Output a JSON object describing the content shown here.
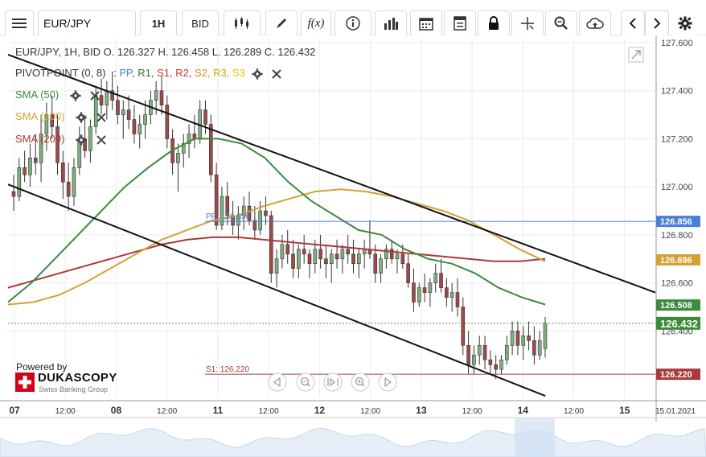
{
  "toolbar": {
    "symbol": "EUR/JPY",
    "period": "1H",
    "price_type": "BID",
    "fx_label": "f(x)",
    "icons": [
      "menu-icon",
      "candles-icon",
      "pencil-icon",
      "function-icon",
      "info-icon",
      "volume-icon",
      "calendar-icon",
      "report-icon",
      "lock-icon",
      "crosshair-icon",
      "zoom-icon",
      "cloud-upload-icon",
      "prev-icon",
      "next-icon",
      "gear-icon"
    ]
  },
  "legend": {
    "ohlc": "EUR/JPY, 1H, BID    O. 126.327 H. 126.458 L. 126.289 C. 126.432",
    "pivot_label": "PIVOTPOINT (0, 8)",
    "pivot_colon": ":",
    "pivot_items": [
      {
        "text": "PP,",
        "color": "#4a7fd4"
      },
      {
        "text": "R1,",
        "color": "#2b7a2b"
      },
      {
        "text": "S1,",
        "color": "#c0392b"
      },
      {
        "text": "R2,",
        "color": "#c0392b"
      },
      {
        "text": "S2,",
        "color": "#e08a1e"
      },
      {
        "text": "R3,",
        "color": "#d4a900"
      },
      {
        "text": "S3",
        "color": "#e0c400"
      }
    ],
    "sma50": "SMA (50)",
    "sma100": "SMA (100)",
    "sma200": "SMA (200)",
    "colors": {
      "sma50": "#3d8a3d",
      "sma100": "#d4a233",
      "sma200": "#a83a3a"
    }
  },
  "overlay_labels": {
    "pp": "PP: 126.856",
    "s1": "S1: 126.220"
  },
  "branding": {
    "powered": "Powered by",
    "name": "DUKASCOPY",
    "sub": "Swiss Banking Group"
  },
  "chart_data": {
    "type": "candlestick",
    "symbol": "EUR/JPY",
    "timeframe": "1H",
    "ylim": [
      126.12,
      127.62
    ],
    "y_ticks": [
      "127.600",
      "127.400",
      "127.200",
      "127.000",
      "126.800",
      "126.600",
      "126.400"
    ],
    "x_ticks": [
      "07",
      "12:00",
      "08",
      "12:00",
      "11",
      "12:00",
      "12",
      "12:00",
      "13",
      "12:00",
      "14",
      "12:00",
      "15",
      "15.01.2021"
    ],
    "price_tags": [
      {
        "label": "126.856",
        "value": 126.856,
        "color": "#4a7fd4"
      },
      {
        "label": "126.696",
        "value": 126.696,
        "color": "#d4a233"
      },
      {
        "label": "126.508",
        "value": 126.508,
        "color": "#3d8a3d"
      },
      {
        "label": "126.432",
        "value": 126.432,
        "color": "#3d8a3d"
      },
      {
        "label": "126.220",
        "value": 126.22,
        "color": "#a83a3a"
      }
    ],
    "levels": {
      "pp": 126.856,
      "s1": 126.22
    },
    "candles": [
      [
        126.98,
        127.05,
        126.9,
        126.96
      ],
      [
        126.96,
        127.12,
        126.94,
        127.08
      ],
      [
        127.08,
        127.15,
        127.02,
        127.05
      ],
      [
        127.05,
        127.18,
        127.0,
        127.12
      ],
      [
        127.12,
        127.22,
        127.05,
        127.1
      ],
      [
        127.1,
        127.3,
        127.02,
        127.22
      ],
      [
        127.22,
        127.35,
        127.15,
        127.3
      ],
      [
        127.3,
        127.38,
        127.2,
        127.25
      ],
      [
        127.25,
        127.3,
        127.05,
        127.1
      ],
      [
        127.1,
        127.15,
        126.95,
        127.02
      ],
      [
        127.02,
        127.1,
        126.9,
        126.96
      ],
      [
        126.96,
        127.12,
        126.92,
        127.08
      ],
      [
        127.08,
        127.25,
        127.05,
        127.2
      ],
      [
        127.2,
        127.3,
        127.12,
        127.15
      ],
      [
        127.15,
        127.28,
        127.1,
        127.25
      ],
      [
        127.25,
        127.42,
        127.22,
        127.38
      ],
      [
        127.38,
        127.45,
        127.3,
        127.34
      ],
      [
        127.34,
        127.44,
        127.28,
        127.4
      ],
      [
        127.4,
        127.48,
        127.32,
        127.36
      ],
      [
        127.36,
        127.42,
        127.26,
        127.3
      ],
      [
        127.3,
        127.36,
        127.2,
        127.32
      ],
      [
        127.32,
        127.38,
        127.24,
        127.28
      ],
      [
        127.28,
        127.34,
        127.18,
        127.22
      ],
      [
        127.22,
        127.3,
        127.16,
        127.26
      ],
      [
        127.26,
        127.36,
        127.2,
        127.3
      ],
      [
        127.3,
        127.4,
        127.26,
        127.36
      ],
      [
        127.36,
        127.44,
        127.3,
        127.4
      ],
      [
        127.4,
        127.46,
        127.3,
        127.34
      ],
      [
        127.34,
        127.38,
        127.16,
        127.2
      ],
      [
        127.2,
        127.24,
        127.05,
        127.1
      ],
      [
        127.1,
        127.18,
        126.98,
        127.14
      ],
      [
        127.14,
        127.22,
        127.08,
        127.18
      ],
      [
        127.18,
        127.26,
        127.12,
        127.22
      ],
      [
        127.22,
        127.3,
        127.16,
        127.2
      ],
      [
        127.2,
        127.36,
        127.18,
        127.32
      ],
      [
        127.32,
        127.36,
        127.22,
        127.26
      ],
      [
        127.26,
        127.3,
        127.02,
        127.05
      ],
      [
        127.05,
        127.1,
        126.82,
        126.84
      ],
      [
        126.84,
        127.0,
        126.82,
        126.96
      ],
      [
        126.96,
        127.02,
        126.84,
        126.88
      ],
      [
        126.88,
        126.94,
        126.8,
        126.84
      ],
      [
        126.84,
        126.92,
        126.78,
        126.88
      ],
      [
        126.88,
        126.96,
        126.82,
        126.92
      ],
      [
        126.92,
        126.98,
        126.84,
        126.86
      ],
      [
        126.86,
        126.92,
        126.78,
        126.82
      ],
      [
        126.82,
        126.94,
        126.8,
        126.9
      ],
      [
        126.9,
        126.96,
        126.84,
        126.88
      ],
      [
        126.88,
        126.9,
        126.6,
        126.64
      ],
      [
        126.64,
        126.74,
        126.58,
        126.7
      ],
      [
        126.7,
        126.8,
        126.66,
        126.76
      ],
      [
        126.76,
        126.82,
        126.68,
        126.72
      ],
      [
        126.72,
        126.78,
        126.62,
        126.66
      ],
      [
        126.66,
        126.76,
        126.62,
        126.74
      ],
      [
        126.74,
        126.8,
        126.68,
        126.72
      ],
      [
        126.72,
        126.74,
        126.62,
        126.68
      ],
      [
        126.68,
        126.78,
        126.64,
        126.74
      ],
      [
        126.74,
        126.8,
        126.66,
        126.7
      ],
      [
        126.7,
        126.76,
        126.62,
        126.68
      ],
      [
        126.68,
        126.74,
        126.6,
        126.72
      ],
      [
        126.72,
        126.78,
        126.66,
        126.7
      ],
      [
        126.7,
        126.76,
        126.64,
        126.74
      ],
      [
        126.74,
        126.8,
        126.68,
        126.72
      ],
      [
        126.72,
        126.78,
        126.64,
        126.68
      ],
      [
        126.68,
        126.74,
        126.62,
        126.72
      ],
      [
        126.72,
        126.78,
        126.66,
        126.74
      ],
      [
        126.74,
        126.86,
        126.7,
        126.72
      ],
      [
        126.72,
        126.76,
        126.6,
        126.64
      ],
      [
        126.64,
        126.72,
        126.6,
        126.7
      ],
      [
        126.7,
        126.76,
        126.66,
        126.74
      ],
      [
        126.74,
        126.78,
        126.68,
        126.7
      ],
      [
        126.7,
        126.74,
        126.64,
        126.72
      ],
      [
        126.72,
        126.76,
        126.66,
        126.68
      ],
      [
        126.68,
        126.72,
        126.58,
        126.6
      ],
      [
        126.6,
        126.66,
        126.48,
        126.52
      ],
      [
        126.52,
        126.6,
        126.5,
        126.58
      ],
      [
        126.58,
        126.64,
        126.52,
        126.56
      ],
      [
        126.56,
        126.62,
        126.5,
        126.6
      ],
      [
        126.6,
        126.68,
        126.56,
        126.64
      ],
      [
        126.64,
        126.7,
        126.56,
        126.58
      ],
      [
        126.58,
        126.62,
        126.5,
        126.54
      ],
      [
        126.54,
        126.6,
        126.48,
        126.56
      ],
      [
        126.56,
        126.62,
        126.46,
        126.5
      ],
      [
        126.5,
        126.54,
        126.3,
        126.34
      ],
      [
        126.34,
        126.4,
        126.22,
        126.26
      ],
      [
        126.26,
        126.34,
        126.22,
        126.3
      ],
      [
        126.3,
        126.38,
        126.26,
        126.34
      ],
      [
        126.34,
        126.38,
        126.24,
        126.28
      ],
      [
        126.28,
        126.32,
        126.22,
        126.26
      ],
      [
        126.26,
        126.3,
        126.2,
        126.24
      ],
      [
        126.24,
        126.3,
        126.22,
        126.28
      ],
      [
        126.28,
        126.38,
        126.26,
        126.34
      ],
      [
        126.34,
        126.44,
        126.3,
        126.4
      ],
      [
        126.4,
        126.44,
        126.3,
        126.34
      ],
      [
        126.34,
        126.42,
        126.28,
        126.38
      ],
      [
        126.38,
        126.44,
        126.32,
        126.36
      ],
      [
        126.36,
        126.42,
        126.26,
        126.3
      ],
      [
        126.3,
        126.4,
        126.28,
        126.36
      ],
      [
        126.327,
        126.458,
        126.289,
        126.432
      ]
    ],
    "sma50": [
      126.52,
      126.6,
      126.7,
      126.8,
      126.9,
      127.0,
      127.08,
      127.15,
      127.2,
      127.2,
      127.18,
      127.12,
      127.02,
      126.94,
      126.88,
      126.82,
      126.8,
      126.74,
      126.7,
      126.68,
      126.64,
      126.58,
      126.54,
      126.51
    ],
    "sma100": [
      126.51,
      126.52,
      126.55,
      126.6,
      126.66,
      126.72,
      126.78,
      126.82,
      126.86,
      126.88,
      126.92,
      126.95,
      126.98,
      126.99,
      126.98,
      126.96,
      126.93,
      126.9,
      126.86,
      126.8,
      126.74,
      126.69
    ],
    "sma200": [
      126.58,
      126.61,
      126.64,
      126.67,
      126.7,
      126.73,
      126.76,
      126.78,
      126.79,
      126.79,
      126.78,
      126.77,
      126.76,
      126.75,
      126.74,
      126.73,
      126.72,
      126.71,
      126.7,
      126.69,
      126.69,
      126.7
    ],
    "channel_upper": [
      [
        127.55,
        0.0
      ],
      [
        126.56,
        1.0
      ]
    ],
    "channel_lower": [
      [
        127.01,
        0.0
      ],
      [
        126.13,
        0.83
      ]
    ]
  },
  "nav_controls": [
    "nav-prev-icon",
    "zoom-out-icon",
    "fit-icon",
    "zoom-in-icon",
    "nav-next-icon"
  ]
}
